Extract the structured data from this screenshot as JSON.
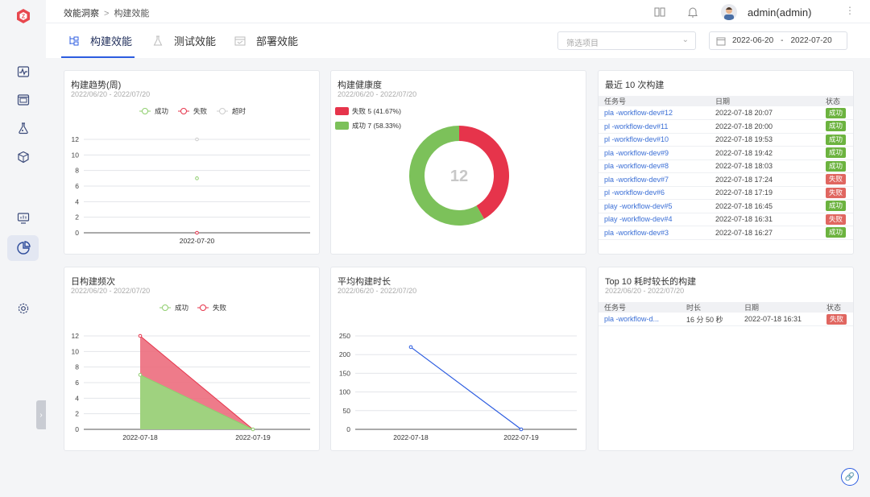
{
  "header": {
    "breadcrumb": [
      "效能洞察",
      "构建效能"
    ],
    "user": "admin(admin)"
  },
  "tabs": [
    {
      "label": "构建效能",
      "active": true
    },
    {
      "label": "测试效能",
      "active": false
    },
    {
      "label": "部署效能",
      "active": false
    }
  ],
  "filter": {
    "placeholder": "筛选项目"
  },
  "date_range": {
    "start": "2022-06-20",
    "sep": "-",
    "end": "2022-07-20"
  },
  "colors": {
    "accent": "#2c5ce0",
    "success": "#7cc15a",
    "fail": "#e6344b",
    "link": "#3b6fd6"
  },
  "cards": {
    "trend": {
      "title": "构建趋势(周)",
      "subtitle": "2022/06/20 - 2022/07/20",
      "legend": [
        "成功",
        "失败",
        "超时"
      ]
    },
    "health": {
      "title": "构建健康度",
      "subtitle": "2022/06/20 - 2022/07/20",
      "legend": [
        "失败 5 (41.67%)",
        "成功 7 (58.33%)"
      ],
      "total": "12"
    },
    "recent": {
      "title": "最近 10 次构建",
      "columns": [
        "任务号",
        "日期",
        "状态"
      ],
      "rows": [
        {
          "job": "pla -workflow-dev#12",
          "date": "2022-07-18 20:07",
          "status": "成功",
          "ok": true
        },
        {
          "job": "pl -workflow-dev#11",
          "date": "2022-07-18 20:00",
          "status": "成功",
          "ok": true
        },
        {
          "job": "pl -workflow-dev#10",
          "date": "2022-07-18 19:53",
          "status": "成功",
          "ok": true
        },
        {
          "job": "pla -workflow-dev#9",
          "date": "2022-07-18 19:42",
          "status": "成功",
          "ok": true
        },
        {
          "job": "pla -workflow-dev#8",
          "date": "2022-07-18 18:03",
          "status": "成功",
          "ok": true
        },
        {
          "job": "pla -workflow-dev#7",
          "date": "2022-07-18 17:24",
          "status": "失败",
          "ok": false
        },
        {
          "job": "pl -workflow-dev#6",
          "date": "2022-07-18 17:19",
          "status": "失败",
          "ok": false
        },
        {
          "job": "play -workflow-dev#5",
          "date": "2022-07-18 16:45",
          "status": "成功",
          "ok": true
        },
        {
          "job": "play -workflow-dev#4",
          "date": "2022-07-18 16:31",
          "status": "失败",
          "ok": false
        },
        {
          "job": "pla -workflow-dev#3",
          "date": "2022-07-18 16:27",
          "status": "成功",
          "ok": true
        }
      ]
    },
    "daily": {
      "title": "日构建频次",
      "subtitle": "2022/06/20 - 2022/07/20",
      "legend": [
        "成功",
        "失败"
      ]
    },
    "avg": {
      "title": "平均构建时长",
      "subtitle": "2022/06/20 - 2022/07/20"
    },
    "top10": {
      "title": "Top 10 耗时较长的构建",
      "subtitle": "2022/06/20 - 2022/07/20",
      "columns": [
        "任务号",
        "时长",
        "日期",
        "状态"
      ],
      "rows": [
        {
          "job": "pla -workflow-d...",
          "duration": "16 分 50 秒",
          "date": "2022-07-18 16:31",
          "status": "失败",
          "ok": false
        }
      ]
    }
  },
  "chart_data": [
    {
      "type": "line",
      "title": "构建趋势(周)",
      "categories": [
        "2022-07-20"
      ],
      "series": [
        {
          "name": "成功",
          "values": [
            7
          ]
        },
        {
          "name": "失败",
          "values": [
            0
          ]
        },
        {
          "name": "超时",
          "values": [
            12
          ]
        }
      ],
      "ylim": [
        0,
        12
      ],
      "yticks": [
        0,
        2,
        4,
        6,
        8,
        10,
        12
      ],
      "legend": "top-center"
    },
    {
      "type": "pie",
      "title": "构建健康度",
      "slices": [
        {
          "name": "失败",
          "value": 5,
          "percent": 41.67,
          "color": "#e6344b"
        },
        {
          "name": "成功",
          "value": 7,
          "percent": 58.33,
          "color": "#7cc15a"
        }
      ],
      "center_label": "12"
    },
    {
      "type": "area",
      "title": "日构建频次",
      "categories": [
        "2022-07-18",
        "2022-07-19"
      ],
      "series": [
        {
          "name": "成功",
          "values": [
            7,
            0
          ],
          "color": "#7cc15a"
        },
        {
          "name": "失败",
          "values": [
            5,
            0
          ],
          "color": "#e6344b"
        }
      ],
      "stacked": true,
      "ylim": [
        0,
        12
      ],
      "yticks": [
        0,
        2,
        4,
        6,
        8,
        10,
        12
      ],
      "legend": "top-center"
    },
    {
      "type": "line",
      "title": "平均构建时长",
      "categories": [
        "2022-07-18",
        "2022-07-19"
      ],
      "series": [
        {
          "values": [
            220,
            0
          ],
          "color": "#2c5ce0"
        }
      ],
      "ylim": [
        0,
        250
      ],
      "yticks": [
        0,
        50,
        100,
        150,
        200,
        250
      ]
    }
  ]
}
